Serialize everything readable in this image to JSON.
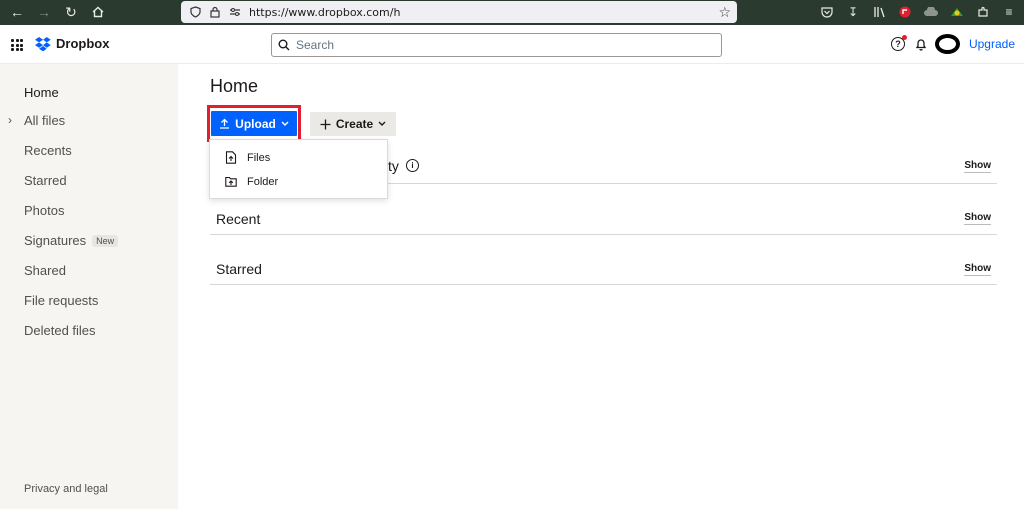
{
  "browser": {
    "url": "https://www.dropbox.com/h"
  },
  "header": {
    "brand": "Dropbox",
    "search_placeholder": "Search",
    "upgrade_label": "Upgrade",
    "help_glyph": "?"
  },
  "sidebar": {
    "items": [
      {
        "label": "Home"
      },
      {
        "label": "All files"
      },
      {
        "label": "Recents"
      },
      {
        "label": "Starred"
      },
      {
        "label": "Photos"
      },
      {
        "label": "Signatures",
        "badge": "New"
      },
      {
        "label": "Shared"
      },
      {
        "label": "File requests"
      },
      {
        "label": "Deleted files"
      }
    ],
    "footer": "Privacy and legal"
  },
  "main": {
    "title": "Home",
    "upload_label": "Upload",
    "create_label": "Create",
    "upload_menu": [
      {
        "label": "Files",
        "icon": "file-upload-icon"
      },
      {
        "label": "Folder",
        "icon": "folder-upload-icon"
      }
    ],
    "sections": [
      {
        "title": "ty",
        "show_label": "Show"
      },
      {
        "title": "Recent",
        "show_label": "Show"
      },
      {
        "title": "Starred",
        "show_label": "Show"
      }
    ]
  },
  "colors": {
    "accent": "#0061fe",
    "highlight": "#e0202e",
    "sidebar_bg": "#f7f5f2"
  }
}
